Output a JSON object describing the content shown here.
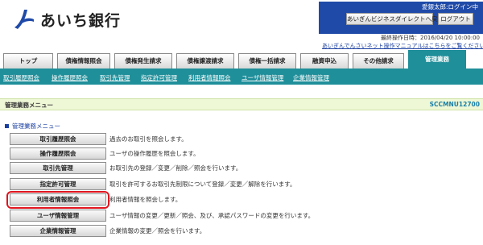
{
  "logo": {
    "text": "あいち銀行",
    "color": "#1f4aa8"
  },
  "header": {
    "user_line": "愛銀太郎:ログイン中",
    "direct_button": "あいぎんビジネスダイレクトへ戻る",
    "logout_button": "ログアウト",
    "last_login": "最終操作日時：2016/04/20 10:00:00",
    "manual_link": "あいぎんでんさいネット操作マニュアルはこちらをご覧ください"
  },
  "tabs": [
    {
      "label": "トップ",
      "active": false
    },
    {
      "label": "債権情報照会",
      "active": false
    },
    {
      "label": "債権発生請求",
      "active": false
    },
    {
      "label": "債権譲渡請求",
      "active": false
    },
    {
      "label": "債権一括請求",
      "active": false
    },
    {
      "label": "融資申込",
      "active": false
    },
    {
      "label": "その他請求",
      "active": false
    },
    {
      "label": "管理業務",
      "active": true
    }
  ],
  "subnav": [
    "取引履歴照会",
    "操作履歴照会",
    "取引先管理",
    "指定許可管理",
    "利用者情報照会",
    "ユーザ情報管理",
    "企業情報管理"
  ],
  "page": {
    "title": "管理業務メニュー",
    "code": "SCCMNU12700",
    "section_title": "管理業務メニュー"
  },
  "menu": [
    {
      "label": "取引履歴照会",
      "desc": "過去のお取引を照会します。"
    },
    {
      "label": "操作履歴照会",
      "desc": "ユーザの操作履歴を照会します。"
    },
    {
      "label": "取引先管理",
      "desc": "お取引先の登録／変更／削除／照会を行います。"
    },
    {
      "label": "指定許可管理",
      "desc": "取引を許可するお取引先制限について登録／変更／解除を行います。"
    },
    {
      "label": "利用者情報照会",
      "desc": "利用者情報を照会します。"
    },
    {
      "label": "ユーザ情報管理",
      "desc": "ユーザ情報の変更／更新／照会、及び、承認パスワードの変更を行います。"
    },
    {
      "label": "企業情報管理",
      "desc": "企業情報の変更／照会を行います。"
    }
  ],
  "colors": {
    "brand_blue": "#1f4aa8",
    "teal": "#1f8f9a",
    "highlight": "#e0141e"
  }
}
